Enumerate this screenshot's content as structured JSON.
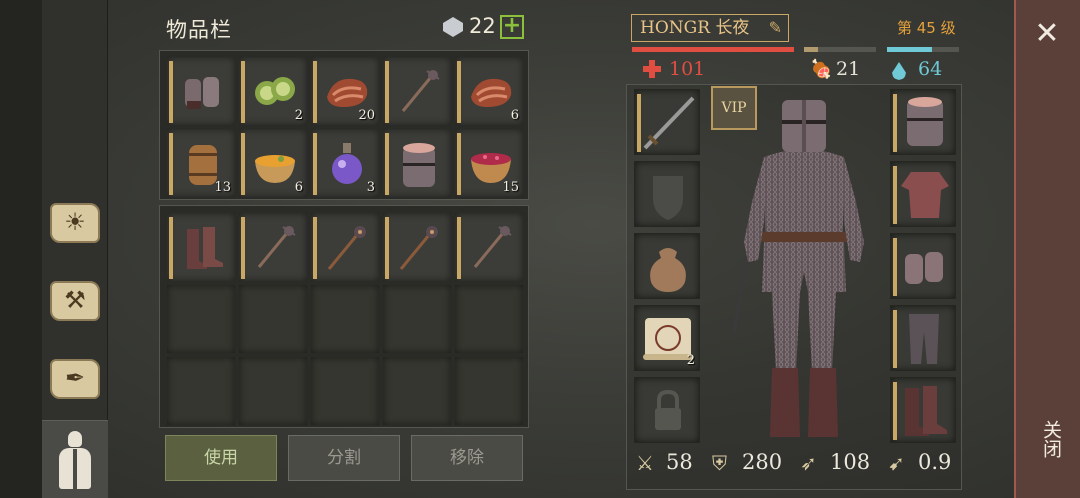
{
  "inventory": {
    "title": "物品栏",
    "gem_count": "22",
    "gem_plus": "+",
    "top_slots": [
      {
        "name": "chainmail-gloves",
        "count": ""
      },
      {
        "name": "cucumber-slices",
        "count": "2"
      },
      {
        "name": "raw-meat",
        "count": "20"
      },
      {
        "name": "mace-spiked",
        "count": ""
      },
      {
        "name": "raw-meat",
        "count": "6"
      },
      {
        "name": "barrel",
        "count": "13"
      },
      {
        "name": "soup-bowl",
        "count": "6"
      },
      {
        "name": "potion-flask",
        "count": "3"
      },
      {
        "name": "knight-helmet",
        "count": ""
      },
      {
        "name": "berry-bowl",
        "count": "15"
      }
    ],
    "bottom_slots": [
      {
        "name": "leather-boots",
        "count": ""
      },
      {
        "name": "mace-spiked",
        "count": ""
      },
      {
        "name": "morning-star",
        "count": ""
      },
      {
        "name": "morning-star",
        "count": ""
      },
      {
        "name": "mace-spiked",
        "count": ""
      }
    ],
    "buttons": {
      "use": "使用",
      "split": "分割",
      "remove": "移除"
    }
  },
  "character": {
    "name_prefix": "HONGR",
    "name_suffix": "长夜",
    "level": "第 45 级",
    "hp": "101",
    "food": "21",
    "water": "64",
    "hp_fraction": 1.0,
    "food_fraction": 0.2,
    "water_fraction": 0.62,
    "vip": "VIP",
    "scroll_count": "2",
    "attack": "58",
    "defense": "280",
    "speed": "108",
    "attack_speed": "0.9"
  },
  "colors": {
    "hp": "#e04e42",
    "food": "#b09a6e",
    "water": "#6fc9d6",
    "accent_gold": "#c9a866",
    "level_orange": "#e5a13a"
  },
  "close": {
    "x": "✕",
    "label": "关闭"
  }
}
